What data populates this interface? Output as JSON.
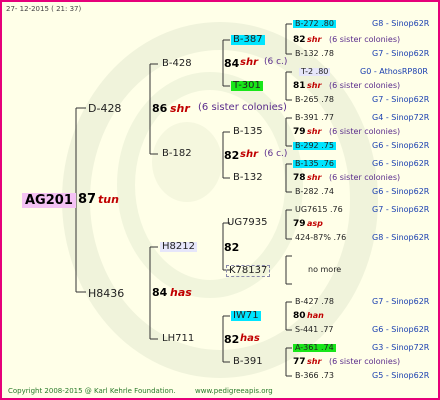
{
  "header": {
    "date": "27- 12-2015 ( 21: 37)"
  },
  "footer": {
    "copyright": "Copyright 2008-2015 @ Karl Kehrle Foundation.",
    "site": "www.pedigreeapis.org"
  },
  "colors": {
    "border": "#e6007a",
    "background": "#ffffe8",
    "link_blue": "#1a3fb0",
    "red_text": "#c00000",
    "cyan_highlight": "#00e5ff",
    "green_highlight": "#19e619",
    "pink_highlight": "#f4c2f4"
  },
  "gen0": {
    "id": "AG201",
    "year": "87",
    "tag": "tun"
  },
  "gen1": [
    {
      "id": "D-428"
    },
    {
      "id": "H8436"
    }
  ],
  "gen1_info": [
    {
      "year": "86",
      "tag": "shr",
      "sib": "(6 sister colonies)"
    },
    {
      "year": "84",
      "tag": "has"
    }
  ],
  "gen2": [
    {
      "id": "B-428"
    },
    {
      "id": "B-182"
    },
    {
      "id": "H8212"
    },
    {
      "id": "LH711"
    }
  ],
  "gen2_info": [
    {
      "year": "84",
      "tag": "shr",
      "sib": "(6 c.)"
    },
    {
      "year": "82",
      "tag": "shr",
      "sib": "(6 c.)"
    },
    {
      "year": "82",
      "tag": ""
    },
    {
      "year": "82",
      "tag": "has"
    }
  ],
  "gen3": [
    {
      "id": "B-387"
    },
    {
      "id": "T-301"
    },
    {
      "id": "B-135"
    },
    {
      "id": "B-132"
    },
    {
      "id": "UG7935"
    },
    {
      "id": "K78137"
    },
    {
      "id": "IW71"
    },
    {
      "id": "B-391"
    }
  ],
  "gen3_info": [
    {
      "year": "79",
      "tag": "asp",
      "extra": "424-87% .76",
      "pedigree": "G8 - Sinop62R"
    },
    {
      "year": "80",
      "tag": "han"
    },
    {
      "year": "77",
      "tag": "shr",
      "sib": "(6 sister colonies)"
    }
  ],
  "gen4": [
    {
      "id": "B-272 .80",
      "pedigree": "G8 - Sinop62R"
    },
    {
      "year": "82",
      "tag": "shr",
      "sib": "(6 sister colonies)"
    },
    {
      "id": "B-132 .78",
      "pedigree": "G7 - Sinop62R"
    },
    {
      "id": "T-2 .80",
      "pedigree": "G0 - AthosRP80R"
    },
    {
      "year": "81",
      "tag": "shr",
      "sib": "(6 sister colonies)"
    },
    {
      "id": "B-265 .78",
      "pedigree": "G7 - Sinop62R"
    },
    {
      "id": "B-391 .77",
      "pedigree": "G4 - Sinop72R"
    },
    {
      "year": "79",
      "tag": "shr",
      "sib": "(6 sister colonies)"
    },
    {
      "id": "B-292 .75",
      "pedigree": "G6 - Sinop62R"
    },
    {
      "id": "B-135 .76",
      "pedigree": "G6 - Sinop62R"
    },
    {
      "year": "78",
      "tag": "shr",
      "sib": "(6 sister colonies)"
    },
    {
      "id": "B-282 .74",
      "pedigree": "G6 - Sinop62R"
    },
    {
      "id": "UG7615 .76",
      "pedigree": "G7 - Sinop62R"
    },
    {
      "nomore": "no more"
    },
    {
      "id": "B-427 .78",
      "pedigree": "G7 - Sinop62R"
    },
    {
      "id": "S-441 .77",
      "pedigree": "G6 - Sinop62R"
    },
    {
      "id": "A-361 .74",
      "pedigree": "G3 - Sinop72R"
    },
    {
      "id": "B-366 .73",
      "pedigree": "G5 - Sinop62R"
    }
  ]
}
